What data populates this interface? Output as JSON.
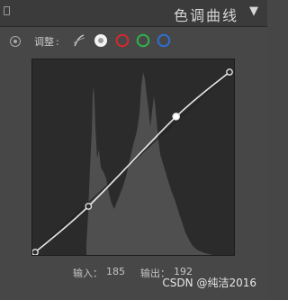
{
  "panel": {
    "title": "色调曲线",
    "collapse_icon": "▼"
  },
  "toolbar": {
    "adjust_label": "调整",
    "colon": ":",
    "channels": [
      {
        "name": "parametric-curve",
        "color": "#bdbdbd"
      },
      {
        "name": "rgb",
        "color": "#ffffff",
        "selected": true
      },
      {
        "name": "red",
        "color": "#d6282e"
      },
      {
        "name": "green",
        "color": "#2fb34a"
      },
      {
        "name": "blue",
        "color": "#2d6fd3"
      }
    ]
  },
  "curve": {
    "points": [
      {
        "input": 0,
        "output": 0
      },
      {
        "input": 70,
        "output": 65
      },
      {
        "input": 185,
        "output": 192
      },
      {
        "input": 255,
        "output": 255
      }
    ],
    "selected_point_index": 2
  },
  "readout": {
    "input_label": "输入：",
    "input_value": "185",
    "output_label": "输出：",
    "output_value": "192"
  },
  "watermark": "CSDN @纯洁2016"
}
